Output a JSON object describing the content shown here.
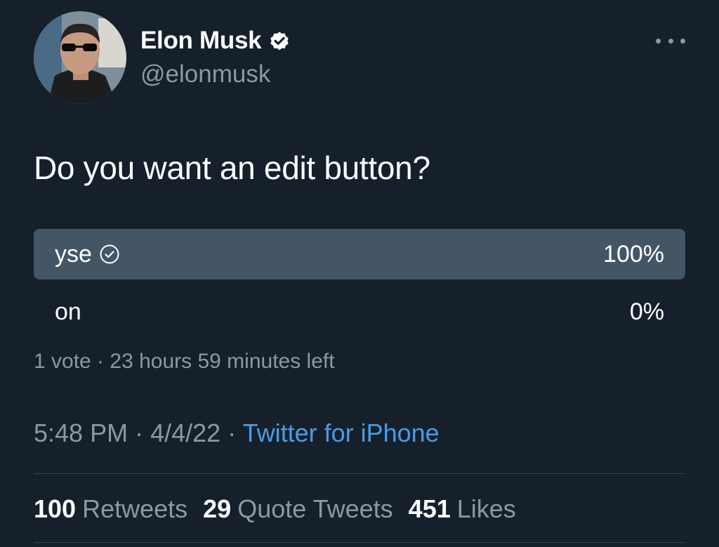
{
  "colors": {
    "background": "#15202b",
    "text_primary": "#ffffff",
    "text_secondary": "#8b98a5",
    "link": "#4a9be8",
    "poll_fill": "#445566",
    "divider": "#38444d"
  },
  "author": {
    "display_name": "Elon Musk",
    "handle": "@elonmusk",
    "verified_icon": "verified-badge-icon",
    "avatar_icon": "avatar"
  },
  "tweet": {
    "text": "Do you want an edit button?"
  },
  "poll": {
    "options": [
      {
        "label": "yse",
        "percent_text": "100%",
        "fraction": 1.0,
        "selected": true
      },
      {
        "label": "on",
        "percent_text": "0%",
        "fraction": 0.0,
        "selected": false
      }
    ],
    "meta": "1 vote · 23 hours 59 minutes left"
  },
  "timestamp": {
    "time": "5:48 PM",
    "date": "4/4/22",
    "separator": "·",
    "source": "Twitter for iPhone"
  },
  "stats": {
    "retweets_count": "100",
    "retweets_label": "Retweets",
    "quotes_count": "29",
    "quotes_label": "Quote Tweets",
    "likes_count": "451",
    "likes_label": "Likes"
  }
}
